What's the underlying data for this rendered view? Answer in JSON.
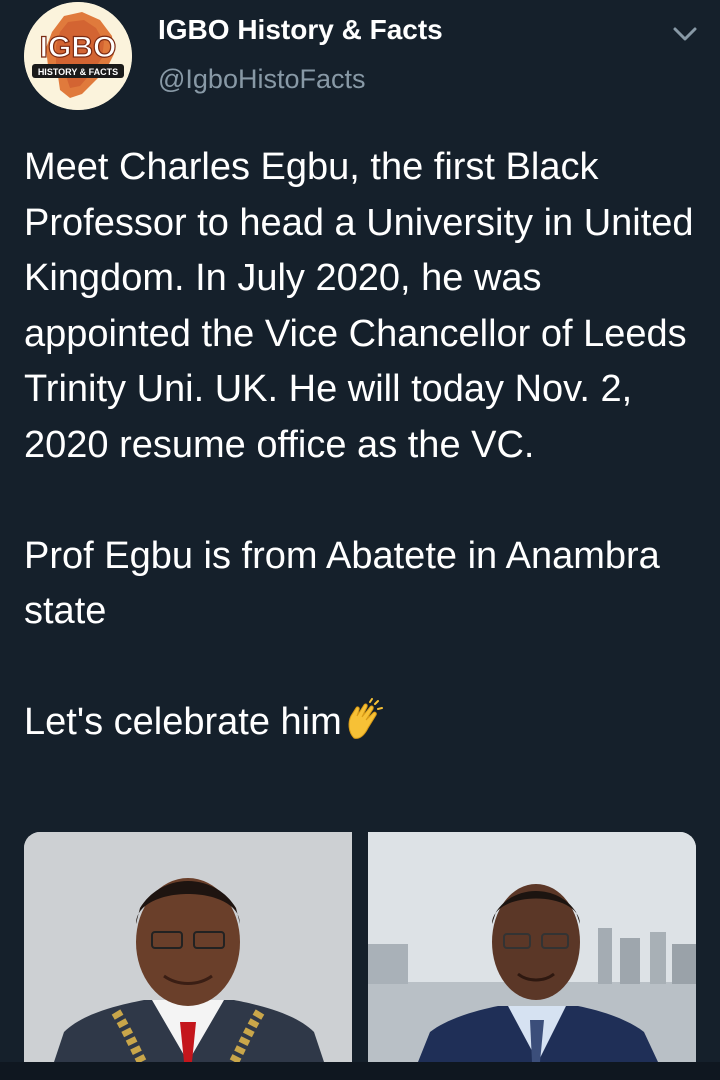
{
  "account": {
    "display_name": "IGBO History & Facts",
    "handle": "@IgboHistoFacts",
    "avatar_logo_text": "IGBO",
    "avatar_logo_subtext": "HISTORY & FACTS"
  },
  "menu": {
    "icon": "chevron-down-icon"
  },
  "tweet": {
    "paragraph_1": "Meet Charles Egbu, the first Black Professor to head a University in United Kingdom. In July 2020, he was appointed the Vice Chancellor of Leeds Trinity Uni. UK. He will today Nov. 2, 2020 resume office as the VC.",
    "paragraph_2": "Prof Egbu is from Abatete in Anambra state",
    "paragraph_3": "Let's celebrate him",
    "emoji": "clapping-hands-icon"
  },
  "media": {
    "count": 2,
    "images": [
      "photo-portrait-with-chain",
      "photo-portrait-waterfront"
    ]
  },
  "colors": {
    "background": "#15202b",
    "text_primary": "#ffffff",
    "text_secondary": "#8899a6",
    "emoji": "#f7c136"
  }
}
